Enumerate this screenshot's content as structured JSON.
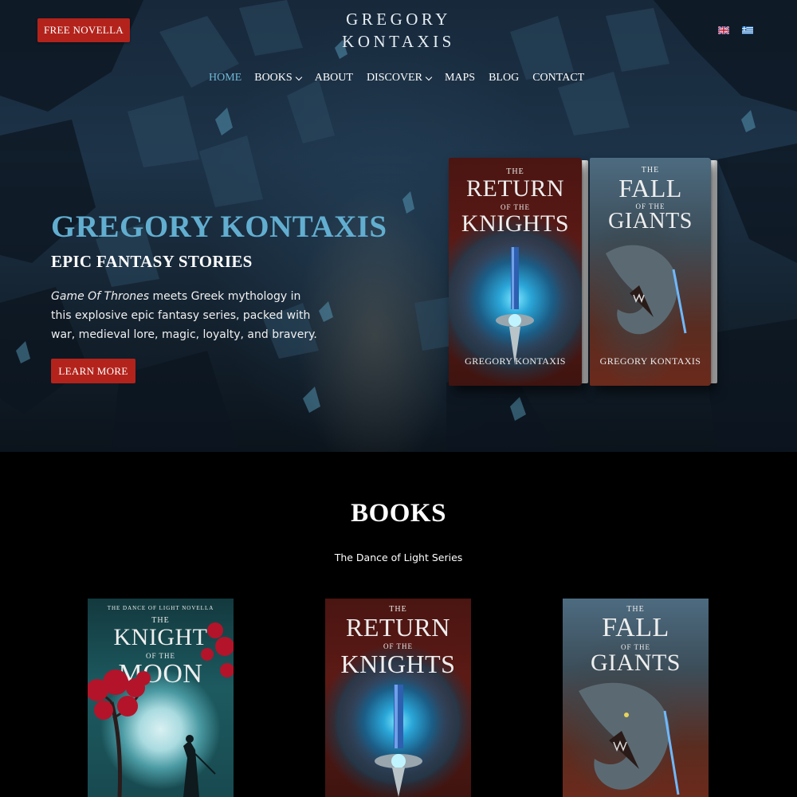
{
  "header": {
    "free_button": "FREE NOVELLA",
    "logo_line1": "GREGORY",
    "logo_line2": "KONTAXIS",
    "languages": [
      "English",
      "Greek"
    ]
  },
  "nav": {
    "items": [
      {
        "label": "HOME",
        "active": true,
        "dropdown": false
      },
      {
        "label": "BOOKS",
        "active": false,
        "dropdown": true
      },
      {
        "label": "ABOUT",
        "active": false,
        "dropdown": false
      },
      {
        "label": "DISCOVER",
        "active": false,
        "dropdown": true
      },
      {
        "label": "MAPS",
        "active": false,
        "dropdown": false
      },
      {
        "label": "BLOG",
        "active": false,
        "dropdown": false
      },
      {
        "label": "CONTACT",
        "active": false,
        "dropdown": false
      }
    ]
  },
  "hero": {
    "title": "GREGORY KONTAXIS",
    "subtitle": "EPIC FANTASY STORIES",
    "desc_em": "Game Of Thrones",
    "desc_rest": " meets Greek mythology in this explosive epic fantasy series, packed with war, medieval lore, magic, loyalty, and bravery.",
    "button": "LEARN MORE"
  },
  "covers": {
    "return": {
      "the": "THE",
      "word1": "RETURN",
      "of": "OF THE",
      "word2": "KNIGHTS",
      "author": "GREGORY KONTAXIS"
    },
    "fall": {
      "the": "THE",
      "word1": "FALL",
      "of": "OF THE",
      "word2": "GIANTS",
      "author": "GREGORY KONTAXIS"
    },
    "knight": {
      "series": "THE DANCE OF LIGHT NOVELLA",
      "the": "THE",
      "word1": "KNIGHT",
      "of": "OF THE",
      "word2": "MOON"
    }
  },
  "books": {
    "title": "BOOKS",
    "series": "The Dance of Light Series"
  },
  "colors": {
    "accent_blue": "#62aed0",
    "button_red": "#b3231c",
    "section_bg": "#000000"
  }
}
